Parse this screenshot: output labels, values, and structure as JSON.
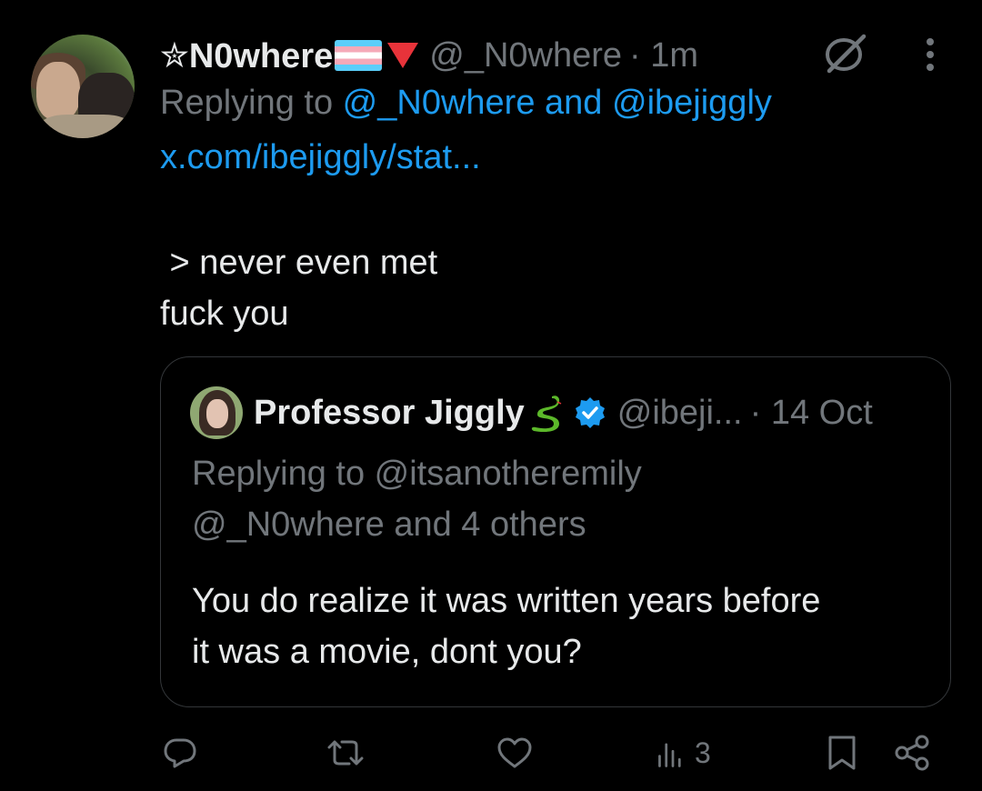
{
  "author": {
    "display_name": "✮N0where",
    "handle": "@_N0where",
    "time": "· 1m"
  },
  "reply_line": {
    "prefix": "Replying to ",
    "mention1": "@_N0where",
    "joiner": " and ",
    "mention2": "@ibejiggly"
  },
  "link": "x.com/ibejiggly/stat...",
  "body": {
    "line1": " > never even met",
    "line2": "fuck you"
  },
  "quote": {
    "display_name": "Professor Jiggly",
    "handle": "@ibeji...",
    "time": "· 14 Oct",
    "reply_line1": "Replying to @itsanotheremily",
    "reply_line2": "@_N0where and 4 others",
    "body_line1": "You do realize it was written years before",
    "body_line2": "it was a movie, dont you?"
  },
  "actions": {
    "views_count": "3"
  },
  "icons": [
    "disabled-icon",
    "more-icon",
    "snake-emoji-icon",
    "verified-badge-icon",
    "reply-icon",
    "repost-icon",
    "like-icon",
    "views-icon",
    "bookmark-icon",
    "share-icon"
  ],
  "colors": {
    "background": "#000000",
    "text": "#e7e9ea",
    "muted": "#71767b",
    "link": "#1d9bf0",
    "border": "#333639"
  }
}
